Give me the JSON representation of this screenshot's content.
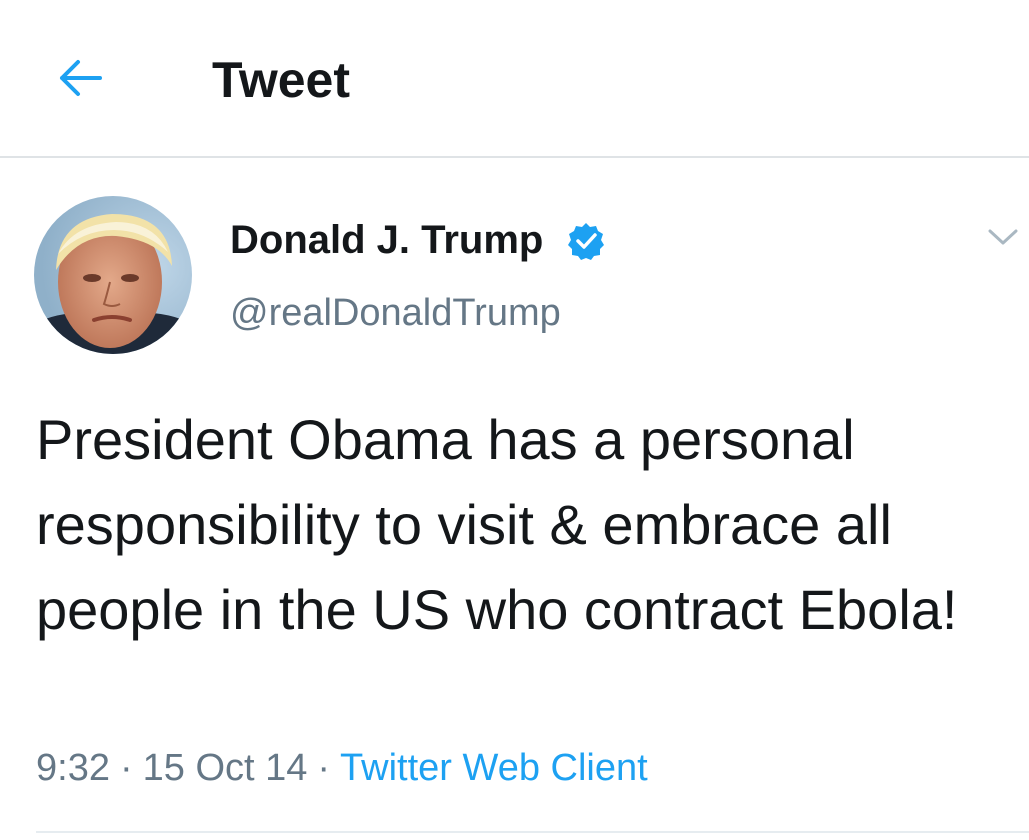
{
  "header": {
    "back_icon": "arrow-left-icon",
    "title": "Tweet"
  },
  "tweet": {
    "author": {
      "display_name": "Donald J. Trump",
      "handle": "@realDonaldTrump",
      "verified": true,
      "verified_icon": "verified-badge-icon"
    },
    "menu_icon": "chevron-down-icon",
    "text": "President Obama has a personal responsibility to visit & embrace all people in the US who contract Ebola!",
    "time": "9:32",
    "date": "15 Oct 14",
    "separator": "·",
    "source": "Twitter Web Client"
  },
  "colors": {
    "accent": "#1da1f2",
    "text_primary": "#14171a",
    "text_secondary": "#657786",
    "divider": "#e6ecf0"
  }
}
